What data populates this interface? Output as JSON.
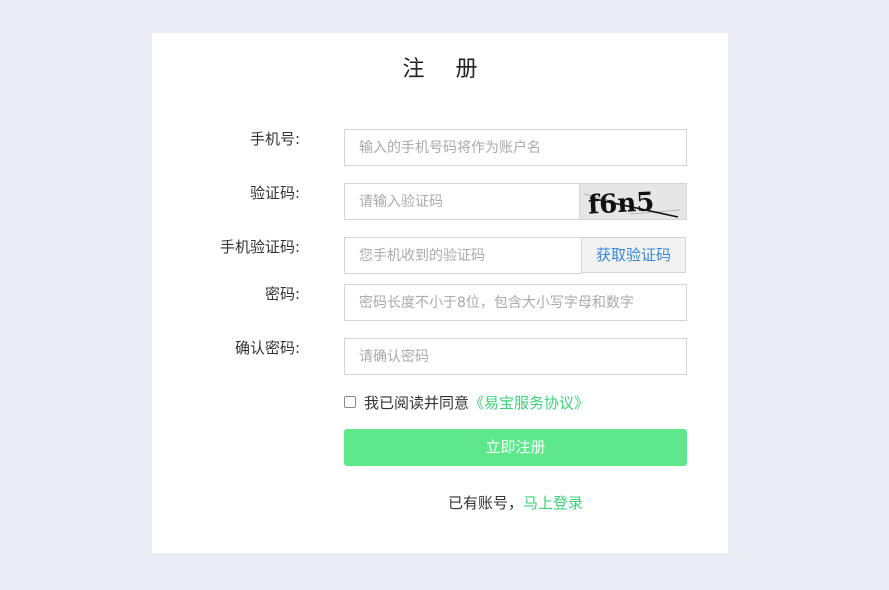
{
  "form": {
    "title": "注 册",
    "phone": {
      "label": "手机号:",
      "placeholder": "输入的手机号码将作为账户名"
    },
    "captcha": {
      "label": "验证码:",
      "placeholder": "请输入验证码",
      "image_text": "f6n5"
    },
    "sms_code": {
      "label": "手机验证码:",
      "placeholder": "您手机收到的验证码",
      "button_label": "获取验证码"
    },
    "password": {
      "label": "密码:",
      "placeholder": "密码长度不小于8位，包含大小写字母和数字"
    },
    "confirm_password": {
      "label": "确认密码:",
      "placeholder": "请确认密码"
    },
    "agreement": {
      "prefix": "我已阅读并同意",
      "link_text": "《易宝服务协议》",
      "checked": false
    },
    "submit_label": "立即注册",
    "login_prompt": {
      "text": "已有账号，",
      "link_text": "马上登录"
    }
  },
  "colors": {
    "page_background": "#eaedf5",
    "card_background": "#ffffff",
    "accent_green": "#5ee88b",
    "link_green": "#3fd07a",
    "link_blue": "#3b86d6"
  }
}
